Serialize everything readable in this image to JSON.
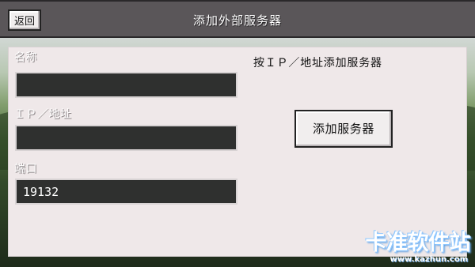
{
  "header": {
    "title": "添加外部服务器",
    "back_label": "返回"
  },
  "form": {
    "name": {
      "label": "名称",
      "value": ""
    },
    "ip_address": {
      "label": "ＩＰ／地址",
      "value": ""
    },
    "port": {
      "label": "端口",
      "value": "19132"
    }
  },
  "side": {
    "hint": "按ＩＰ／地址添加服务器",
    "add_button_label": "添加服务器"
  },
  "watermark": {
    "brand": "卡准软件站",
    "url": "www.kazhun.com"
  },
  "colors": {
    "toolbar": "#5a5659",
    "panel": "#efe8e9",
    "input_background": "#2f302f",
    "button_face": "#f1eeee"
  }
}
